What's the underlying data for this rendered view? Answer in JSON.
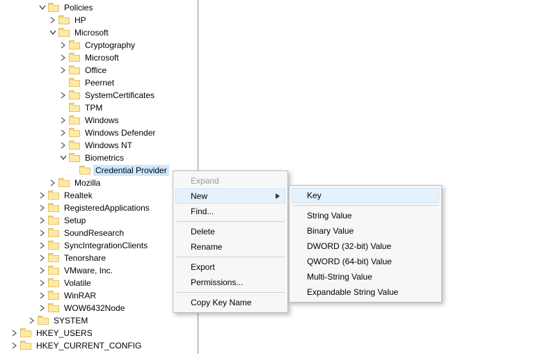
{
  "tree": [
    {
      "indent": 55,
      "chev": "down",
      "label": "Policies"
    },
    {
      "indent": 70,
      "chev": "right",
      "label": "HP"
    },
    {
      "indent": 70,
      "chev": "down",
      "label": "Microsoft"
    },
    {
      "indent": 85,
      "chev": "right",
      "label": "Cryptography"
    },
    {
      "indent": 85,
      "chev": "right",
      "label": "Microsoft"
    },
    {
      "indent": 85,
      "chev": "right",
      "label": "Office"
    },
    {
      "indent": 85,
      "chev": "none",
      "label": "Peernet"
    },
    {
      "indent": 85,
      "chev": "right",
      "label": "SystemCertificates"
    },
    {
      "indent": 85,
      "chev": "none",
      "label": "TPM"
    },
    {
      "indent": 85,
      "chev": "right",
      "label": "Windows"
    },
    {
      "indent": 85,
      "chev": "right",
      "label": "Windows Defender"
    },
    {
      "indent": 85,
      "chev": "right",
      "label": "Windows NT"
    },
    {
      "indent": 85,
      "chev": "down",
      "label": "Biometrics"
    },
    {
      "indent": 100,
      "chev": "none",
      "label": "Credential Provider",
      "selected": true
    },
    {
      "indent": 70,
      "chev": "right",
      "label": "Mozilla"
    },
    {
      "indent": 55,
      "chev": "right",
      "label": "Realtek"
    },
    {
      "indent": 55,
      "chev": "right",
      "label": "RegisteredApplications"
    },
    {
      "indent": 55,
      "chev": "right",
      "label": "Setup"
    },
    {
      "indent": 55,
      "chev": "right",
      "label": "SoundResearch"
    },
    {
      "indent": 55,
      "chev": "right",
      "label": "SyncIntegrationClients"
    },
    {
      "indent": 55,
      "chev": "right",
      "label": "Tenorshare"
    },
    {
      "indent": 55,
      "chev": "right",
      "label": "VMware, Inc."
    },
    {
      "indent": 55,
      "chev": "right",
      "label": "Volatile"
    },
    {
      "indent": 55,
      "chev": "right",
      "label": "WinRAR"
    },
    {
      "indent": 55,
      "chev": "right",
      "label": "WOW6432Node"
    },
    {
      "indent": 40,
      "chev": "right",
      "label": "SYSTEM"
    },
    {
      "indent": 15,
      "chev": "right",
      "label": "HKEY_USERS"
    },
    {
      "indent": 15,
      "chev": "right",
      "label": "HKEY_CURRENT_CONFIG"
    }
  ],
  "context_menu": {
    "expand": "Expand",
    "new": "New",
    "find": "Find...",
    "delete": "Delete",
    "rename": "Rename",
    "export": "Export",
    "permissions": "Permissions...",
    "copy_key_name": "Copy Key Name"
  },
  "new_submenu": {
    "key": "Key",
    "string": "String Value",
    "binary": "Binary Value",
    "dword": "DWORD (32-bit) Value",
    "qword": "QWORD (64-bit) Value",
    "multi": "Multi-String Value",
    "expand": "Expandable String Value"
  }
}
